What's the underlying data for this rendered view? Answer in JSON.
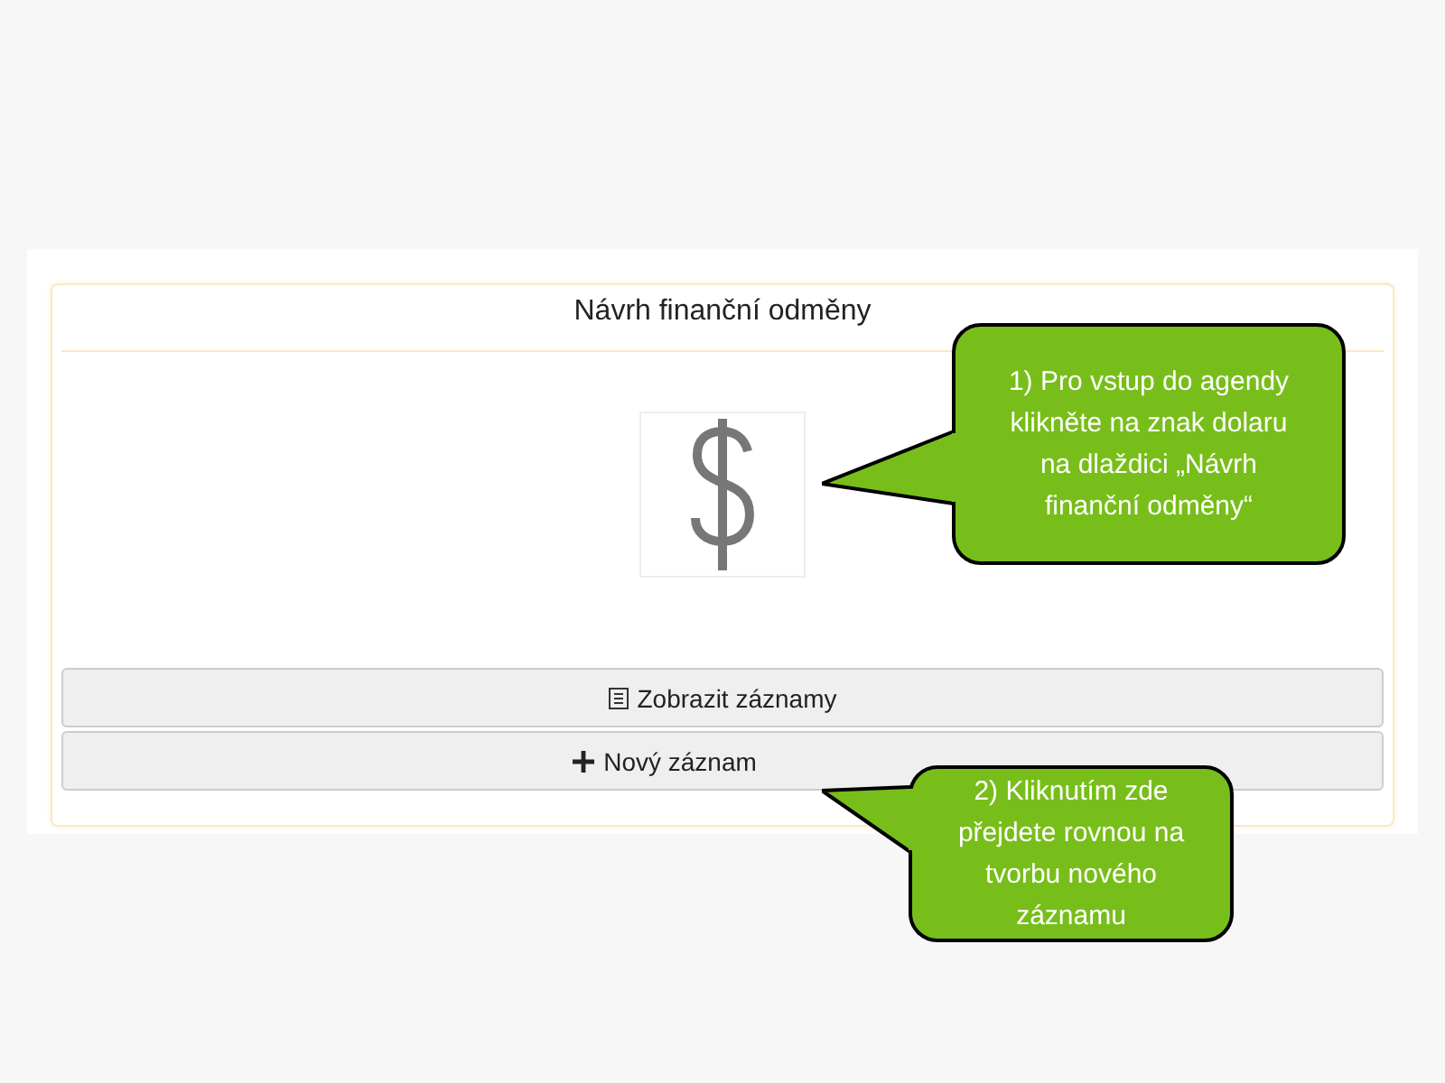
{
  "card": {
    "title": "Návrh finanční odměny",
    "buttons": [
      {
        "label": "Zobrazit záznamy",
        "kind": "list"
      },
      {
        "label": "Nový záznam",
        "kind": "add"
      }
    ]
  },
  "callouts": [
    {
      "text": "1) Pro vstup do agendy klikněte na znak dolaru na dlaždici „Návrh finanční odměny“"
    },
    {
      "text": "2) Kliknutím zde přejdete rovnou na tvorbu nového záznamu"
    }
  ]
}
